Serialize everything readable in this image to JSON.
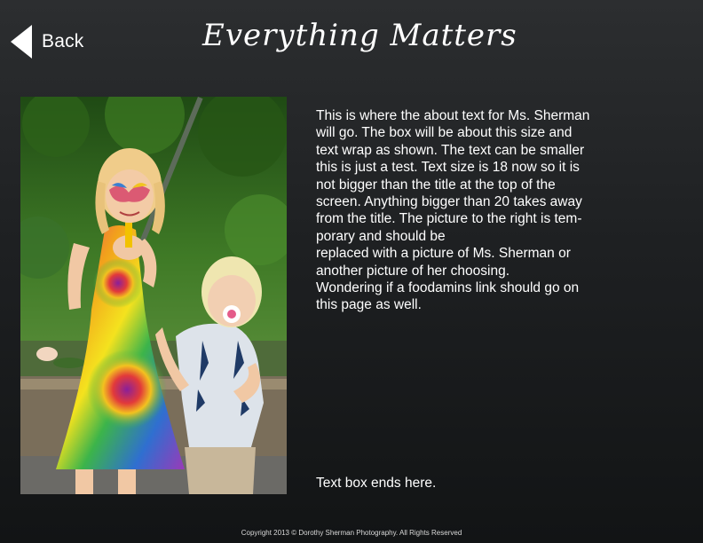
{
  "header": {
    "back_label": "Back",
    "title": "Everything Matters"
  },
  "about": {
    "lines": [
      "This is where the about text for Ms. Sherman",
      "will go. The box will be about this size and",
      "text wrap as shown. The text can be smaller",
      "this is just a test. Text size is 18 now so it is",
      "not bigger than the title at the top of the",
      "screen. Anything bigger than 20 takes away",
      "from the title. The picture to the right is tem-",
      "porary and should be",
      "replaced with a picture of Ms. Sherman or",
      "another picture of her choosing.",
      "Wondering if a foodamins link should go on",
      "this page as well."
    ],
    "end_text": "Text box ends here."
  },
  "footer": {
    "copyright": "Copyright 2013 © Dorothy Sherman Photography. All Rights Reserved"
  },
  "colors": {
    "background_top": "#2c2e30",
    "background_bottom": "#121415",
    "text": "#ffffff"
  }
}
